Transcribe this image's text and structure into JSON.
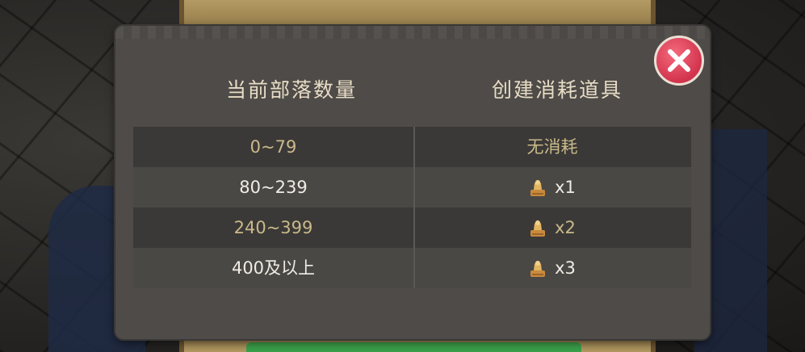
{
  "headers": {
    "tribe_count": "当前部落数量",
    "creation_cost": "创建消耗道具"
  },
  "rows": [
    {
      "range": "0~79",
      "cost_text": "无消耗",
      "has_item": false
    },
    {
      "range": "80~239",
      "cost_count": "x1",
      "has_item": true
    },
    {
      "range": "240~399",
      "cost_count": "x2",
      "has_item": true
    },
    {
      "range": "400及以上",
      "cost_count": "x3",
      "has_item": true
    }
  ],
  "item_icon": "gold-token-icon",
  "colors": {
    "panel": "#4e4b48",
    "gold_text": "#c9b98a",
    "white_text": "#f0ece4",
    "close_button": "#d2344d"
  }
}
